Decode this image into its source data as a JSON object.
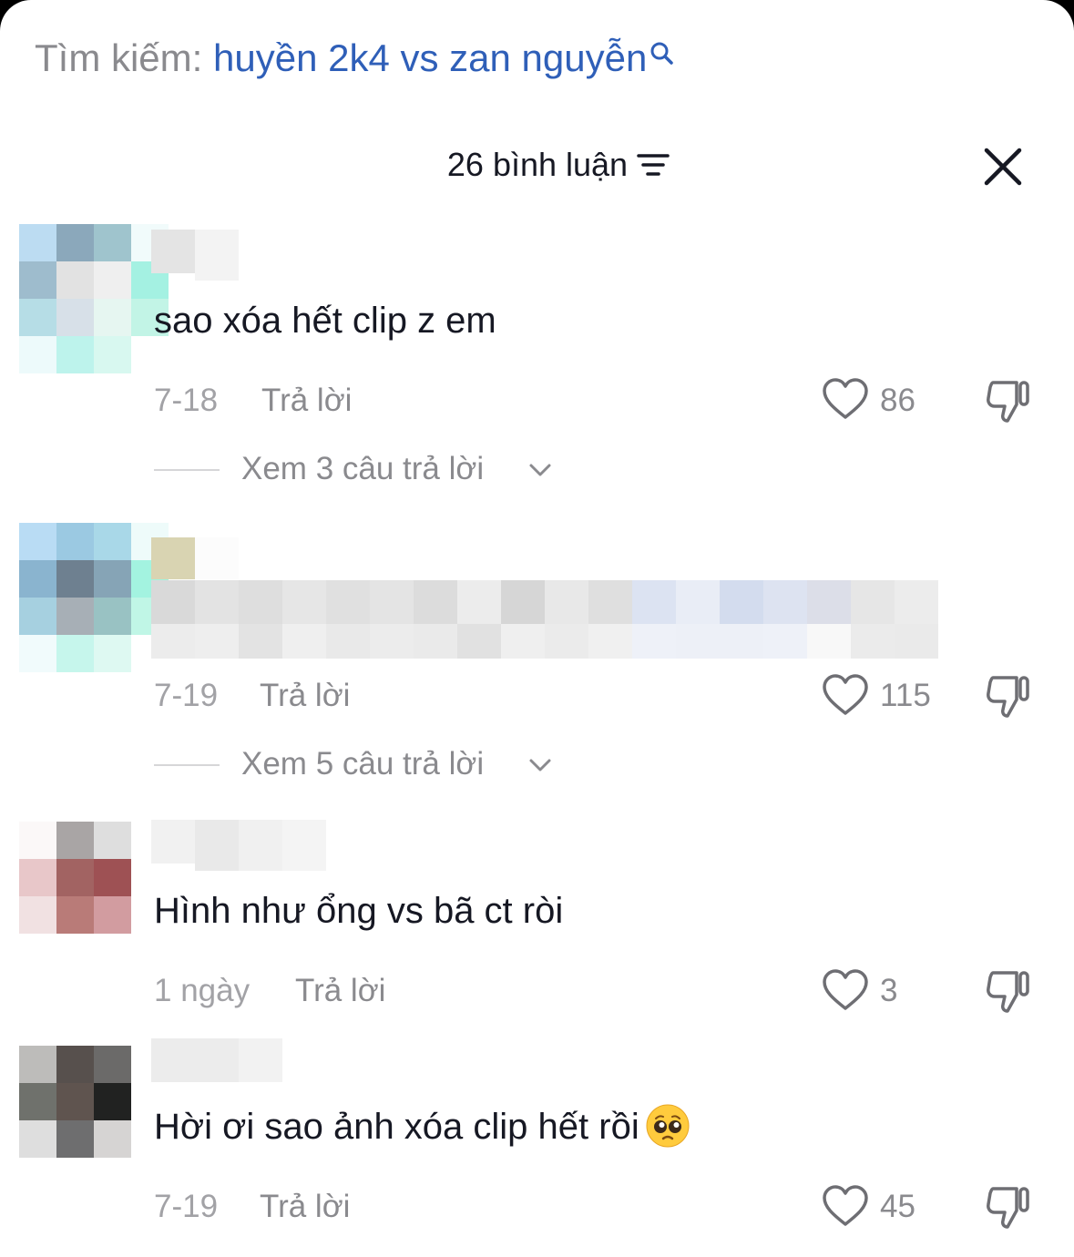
{
  "search": {
    "prefix": "Tìm kiếm:",
    "query": "huyền 2k4 vs zan nguyễn",
    "icon": "search-icon",
    "query_color": "#2f5fb8"
  },
  "header": {
    "title": "26 bình luận",
    "sort_icon": "sort-icon",
    "close_icon": "close-icon"
  },
  "comments": [
    {
      "text": "sao xóa hết clip z em",
      "date": "7-18",
      "reply_label": "Trả lời",
      "likes": "86",
      "replies_label": "Xem 3 câu trả lời"
    },
    {
      "text": "",
      "date": "7-19",
      "reply_label": "Trả lời",
      "likes": "115",
      "replies_label": "Xem 5 câu trả lời"
    },
    {
      "text": "Hình như ổng vs bã ct ròi",
      "date": "1 ngày",
      "reply_label": "Trả lời",
      "likes": "3"
    },
    {
      "text": "Hời ơi sao ảnh xóa clip hết rồi",
      "emoji": "pleading-face-emoji",
      "date": "7-19",
      "reply_label": "Trả lời",
      "likes": "45"
    }
  ],
  "colors": {
    "text": "#161823",
    "muted": "#8a8a8e",
    "date": "#a2a2a6"
  }
}
